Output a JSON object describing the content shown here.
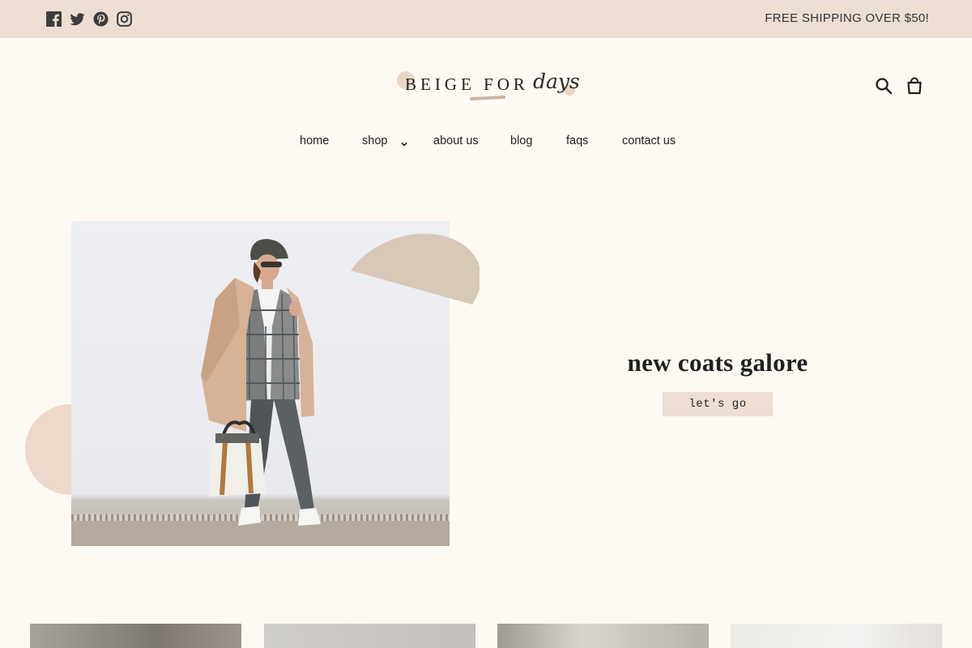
{
  "announcement": {
    "text": "FREE SHIPPING OVER $50!",
    "social": [
      "facebook-icon",
      "twitter-icon",
      "pinterest-icon",
      "instagram-icon"
    ]
  },
  "header": {
    "logo_main": "BEIGE FOR",
    "logo_script": "days",
    "icons": [
      "search-icon",
      "cart-icon"
    ]
  },
  "nav": {
    "items": [
      "home",
      "shop",
      "about us",
      "blog",
      "faqs",
      "contact us"
    ]
  },
  "hero": {
    "heading": "new coats galore",
    "button": "let's go"
  },
  "colors": {
    "background": "#fdf9f3",
    "accent_beige": "#ecdfd2",
    "semicircle": "#d8c8b7",
    "circle": "#ecd9cb"
  }
}
